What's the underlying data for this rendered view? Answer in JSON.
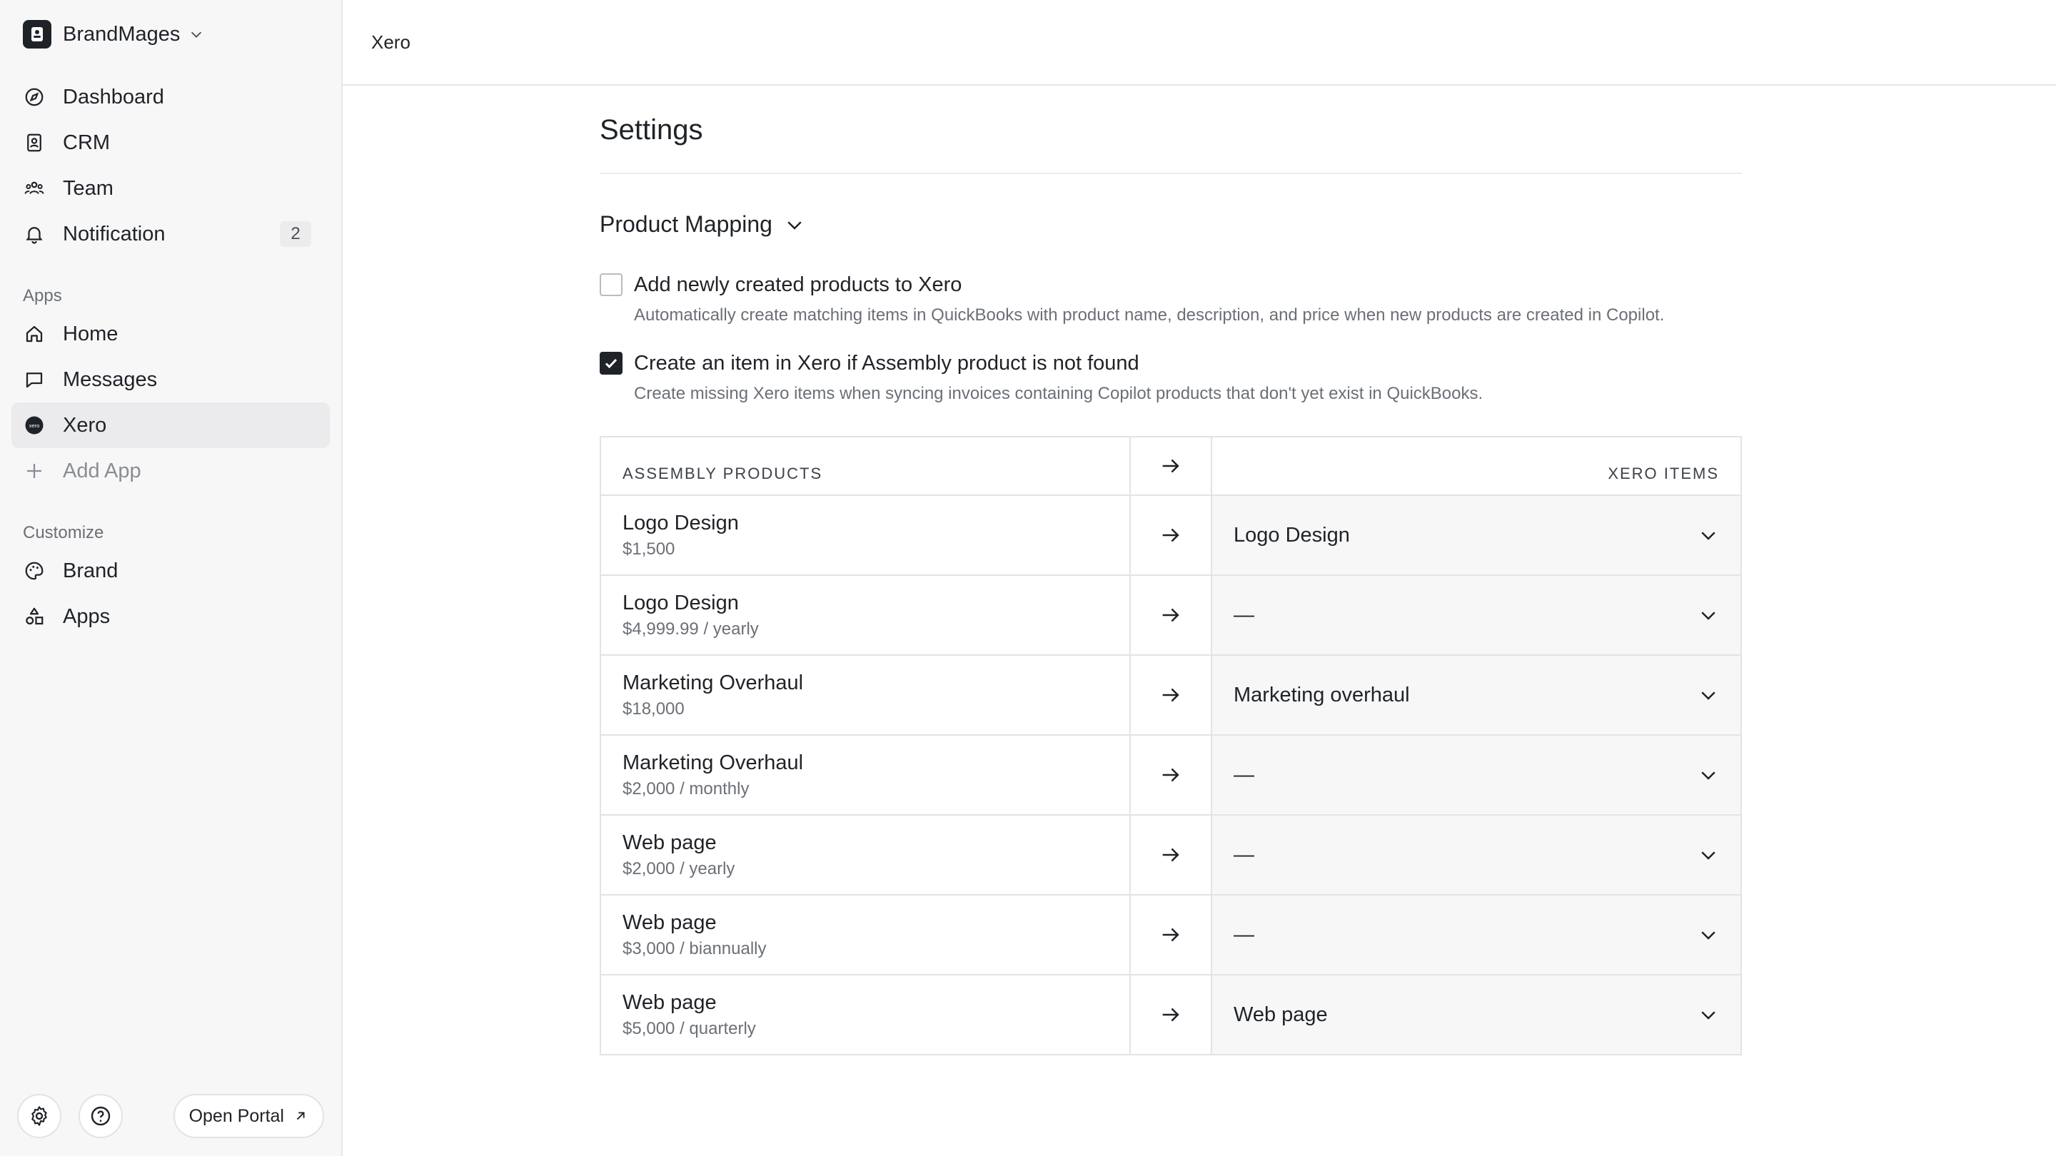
{
  "workspace": {
    "name": "BrandMages"
  },
  "nav": {
    "main": [
      {
        "label": "Dashboard",
        "icon": "compass-icon"
      },
      {
        "label": "CRM",
        "icon": "contact-book-icon"
      },
      {
        "label": "Team",
        "icon": "team-icon"
      },
      {
        "label": "Notification",
        "icon": "bell-icon",
        "badge": "2"
      }
    ],
    "apps_label": "Apps",
    "apps": [
      {
        "label": "Home",
        "icon": "home-icon"
      },
      {
        "label": "Messages",
        "icon": "message-icon"
      },
      {
        "label": "Xero",
        "icon": "xero-icon",
        "active": true
      },
      {
        "label": "Add App",
        "icon": "plus-icon"
      }
    ],
    "customize_label": "Customize",
    "customize": [
      {
        "label": "Brand",
        "icon": "palette-icon"
      },
      {
        "label": "Apps",
        "icon": "shapes-icon"
      }
    ]
  },
  "footer": {
    "open_portal": "Open Portal"
  },
  "topbar": {
    "title": "Xero"
  },
  "settings": {
    "title": "Settings",
    "section": "Product Mapping",
    "options": [
      {
        "checked": false,
        "title": "Add newly created products to Xero",
        "desc": "Automatically create matching items in QuickBooks with product name, description, and price when new products are created in Copilot."
      },
      {
        "checked": true,
        "title": "Create an item in Xero if Assembly product is not found",
        "desc": "Create missing Xero items when syncing invoices containing Copilot products that don't yet exist in QuickBooks."
      }
    ]
  },
  "mapping": {
    "col_assembly": "ASSEMBLY PRODUCTS",
    "col_xero": "XERO ITEMS",
    "rows": [
      {
        "name": "Logo Design",
        "price": "$1,500",
        "xero": "Logo Design"
      },
      {
        "name": "Logo Design",
        "price": "$4,999.99 / yearly",
        "xero": "—"
      },
      {
        "name": "Marketing Overhaul",
        "price": "$18,000",
        "xero": "Marketing overhaul"
      },
      {
        "name": "Marketing Overhaul",
        "price": "$2,000 / monthly",
        "xero": "—"
      },
      {
        "name": "Web page",
        "price": "$2,000 / yearly",
        "xero": "—"
      },
      {
        "name": "Web page",
        "price": "$3,000 / biannually",
        "xero": "—"
      },
      {
        "name": "Web page",
        "price": "$5,000 / quarterly",
        "xero": "Web page"
      }
    ]
  }
}
